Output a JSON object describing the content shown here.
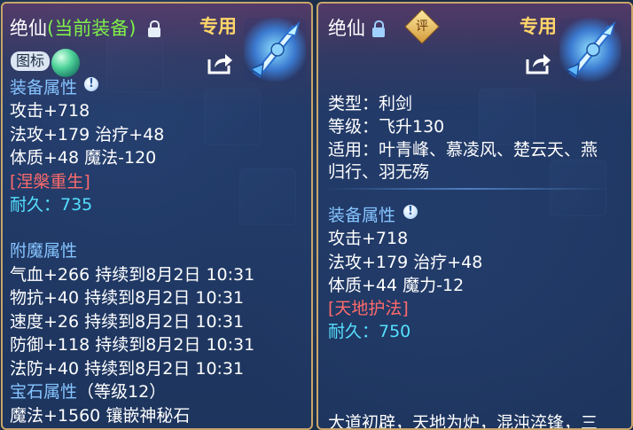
{
  "left_panel": {
    "title": "绝仙",
    "title_status": "(当前装备)",
    "badge_exclusive": "专用",
    "icon_button_label": "图标",
    "equipment_attr_header": "装备属性",
    "attack": "攻击+718",
    "magic_attack_heal": "法攻+179 治疗+48",
    "physique_mana": "体质+48 魔法-120",
    "special_skill": "[涅槃重生]",
    "durability": "耐久：735",
    "enchant_header": "附魔属性",
    "enchant_lines": [
      "气血+266 持续到8月2日 10:31",
      "物抗+40 持续到8月2日 10:31",
      "速度+26 持续到8月2日 10:31",
      "防御+118 持续到8月2日 10:31",
      "法防+40 持续到8月2日 10:31"
    ],
    "gem_header": "宝石属性",
    "gem_level": "（等级12）",
    "gem_line": "魔法+1560 镶嵌神秘石"
  },
  "right_panel": {
    "title": "绝仙",
    "eval_badge": "评",
    "badge_exclusive": "专用",
    "type": "类型：利剑",
    "level": "等级：飞升130",
    "suitable_line1": "适用：叶青峰、慕凌风、楚云天、燕",
    "suitable_line2": "归行、羽无殇",
    "equipment_attr_header": "装备属性",
    "attack": "攻击+718",
    "magic_attack_heal": "法攻+179 治疗+48",
    "physique_magic_power": "体质+44 魔力-12",
    "special_skill": "[天地护法]",
    "durability": "耐久：750",
    "description": "大道初辟，天地为炉，混沌淬锋，三"
  },
  "colors": {
    "panel_border": "#c9a56a",
    "section_header": "#86c4ff",
    "status_green": "#7ef04a",
    "exclusive_gold": "#ffd66a",
    "special_red": "#ff6b6b",
    "durability_cyan": "#55e0ff"
  }
}
